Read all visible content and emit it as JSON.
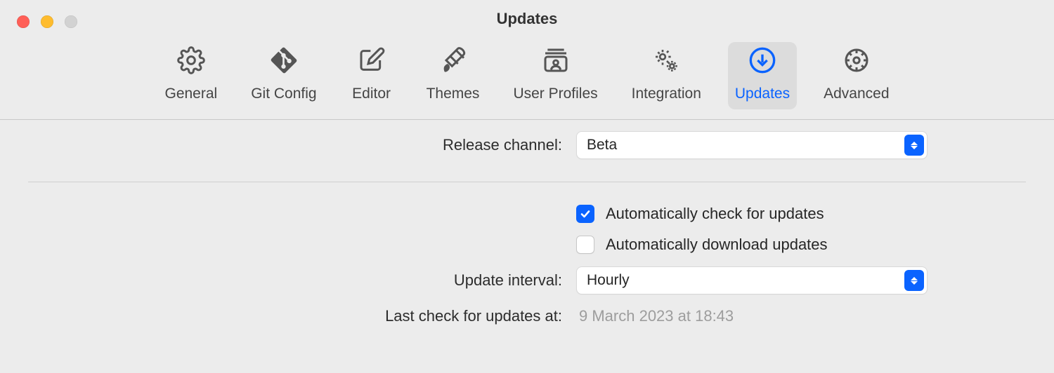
{
  "window": {
    "title": "Updates"
  },
  "toolbar": {
    "items": [
      {
        "label": "General"
      },
      {
        "label": "Git Config"
      },
      {
        "label": "Editor"
      },
      {
        "label": "Themes"
      },
      {
        "label": "User Profiles"
      },
      {
        "label": "Integration"
      },
      {
        "label": "Updates"
      },
      {
        "label": "Advanced"
      }
    ],
    "selected_index": 6
  },
  "form": {
    "release_channel": {
      "label": "Release channel:",
      "value": "Beta"
    },
    "auto_check": {
      "label": "Automatically check for updates",
      "checked": true
    },
    "auto_download": {
      "label": "Automatically download updates",
      "checked": false
    },
    "update_interval": {
      "label": "Update interval:",
      "value": "Hourly"
    },
    "last_check": {
      "label": "Last check for updates at:",
      "value": "9 March 2023 at 18:43"
    }
  }
}
